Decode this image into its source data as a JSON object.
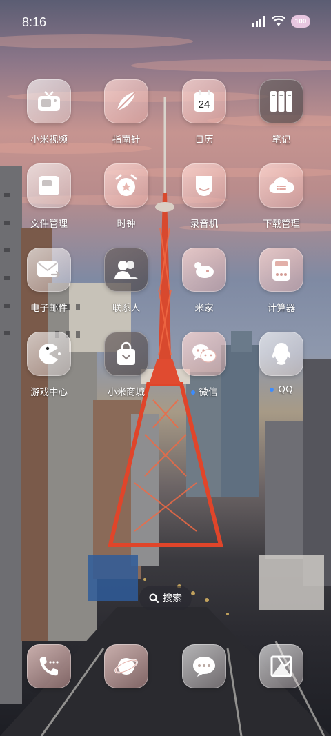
{
  "status_bar": {
    "time": "8:16",
    "battery": "100"
  },
  "apps": [
    {
      "label": "小米视频",
      "icon": "tv-icon"
    },
    {
      "label": "指南针",
      "icon": "compass-icon"
    },
    {
      "label": "日历",
      "icon": "calendar-icon",
      "badge_text": "24"
    },
    {
      "label": "笔记",
      "icon": "notes-icon"
    },
    {
      "label": "文件管理",
      "icon": "folder-icon"
    },
    {
      "label": "时钟",
      "icon": "alarm-clock-icon"
    },
    {
      "label": "录音机",
      "icon": "recorder-icon"
    },
    {
      "label": "下载管理",
      "icon": "download-cloud-icon"
    },
    {
      "label": "电子邮件",
      "icon": "mail-icon"
    },
    {
      "label": "联系人",
      "icon": "contacts-icon"
    },
    {
      "label": "米家",
      "icon": "mijia-icon"
    },
    {
      "label": "计算器",
      "icon": "calculator-icon"
    },
    {
      "label": "游戏中心",
      "icon": "game-icon"
    },
    {
      "label": "小米商城",
      "icon": "shopping-bag-icon"
    },
    {
      "label": "微信",
      "icon": "wechat-icon",
      "new_dot": true
    },
    {
      "label": "QQ",
      "icon": "qq-icon",
      "new_dot": true
    }
  ],
  "search": {
    "label": "搜索"
  },
  "dock": [
    {
      "icon": "phone-icon"
    },
    {
      "icon": "browser-icon"
    },
    {
      "icon": "messages-icon"
    },
    {
      "icon": "gallery-icon"
    }
  ]
}
